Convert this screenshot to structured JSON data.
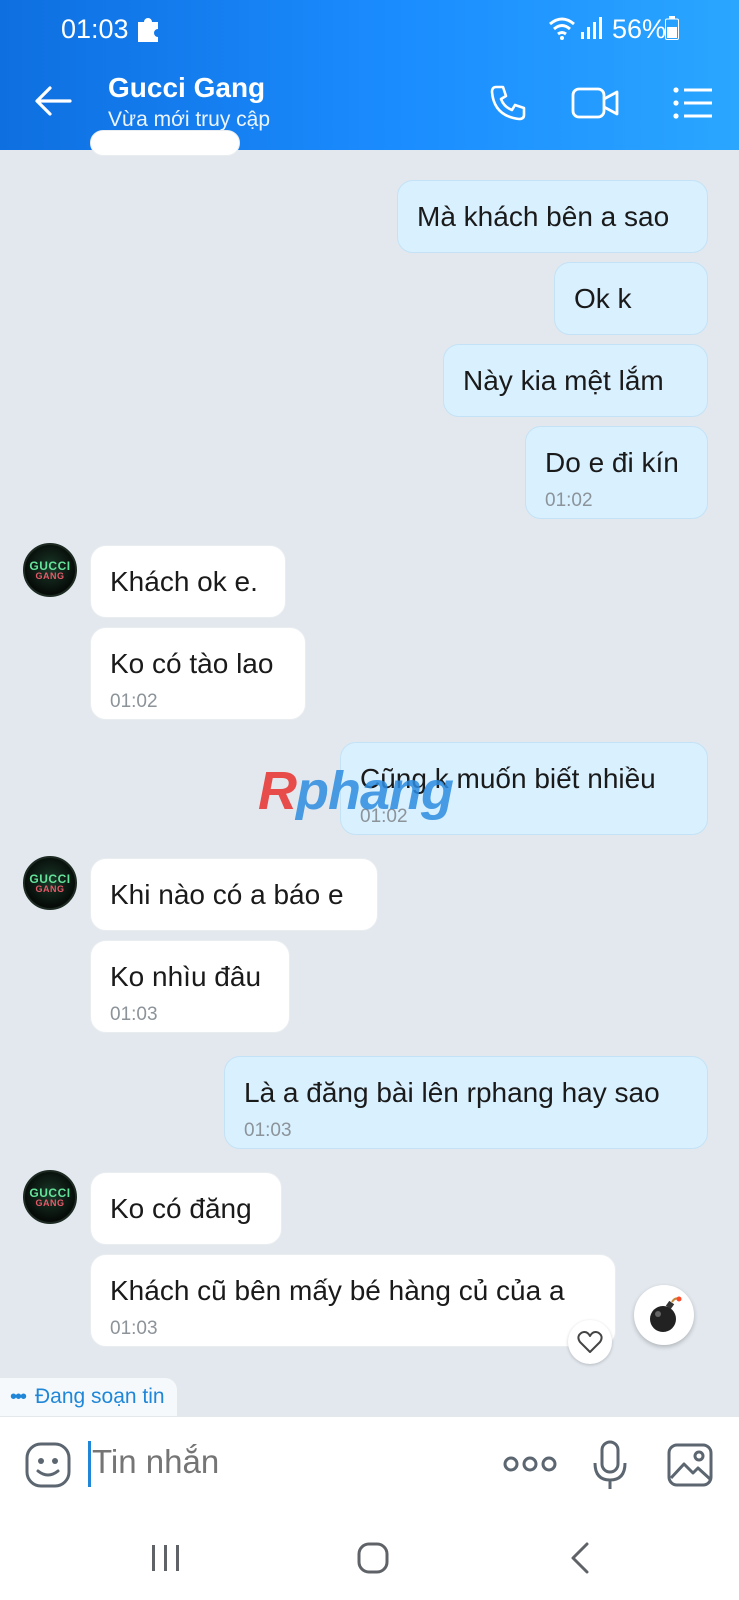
{
  "status_bar": {
    "time": "01:03",
    "battery_pct": "56%"
  },
  "header": {
    "title": "Gucci Gang",
    "subtitle": "Vừa mới truy cập"
  },
  "avatar_text": {
    "line1": "GUCCI",
    "line2": "GANG"
  },
  "messages": [
    {
      "side": "me",
      "text": "Mà khách bên a sao"
    },
    {
      "side": "me",
      "text": "Ok k"
    },
    {
      "side": "me",
      "text": "Này kia mệt lắm"
    },
    {
      "side": "me",
      "text": "Do e đi kín",
      "time": "01:02"
    },
    {
      "side": "them",
      "text": "Khách ok e."
    },
    {
      "side": "them",
      "text": "Ko có tào lao",
      "time": "01:02"
    },
    {
      "side": "me",
      "text": "Cũng k muốn biết nhiều",
      "time": "01:02"
    },
    {
      "side": "them",
      "text": "Khi nào có a báo e"
    },
    {
      "side": "them",
      "text": "Ko nhìu đâu",
      "time": "01:03"
    },
    {
      "side": "me",
      "text": "Là a đăng bài lên rphang hay sao",
      "time": "01:03"
    },
    {
      "side": "them",
      "text": "Ko có đăng"
    },
    {
      "side": "them",
      "text": "Khách cũ bên mấy bé hàng củ của a",
      "time": "01:03"
    }
  ],
  "watermark": {
    "r": "R",
    "rest": "phang"
  },
  "typing_indicator": "Đang soạn tin",
  "composer": {
    "placeholder": "Tin nhắn"
  },
  "colors": {
    "header_start": "#0e6fe0",
    "header_end": "#2aa6ff",
    "my_bubble": "#d9f0ff",
    "their_bubble": "#ffffff",
    "chat_bg": "#e2e8ee",
    "accent": "#1f86d8"
  }
}
